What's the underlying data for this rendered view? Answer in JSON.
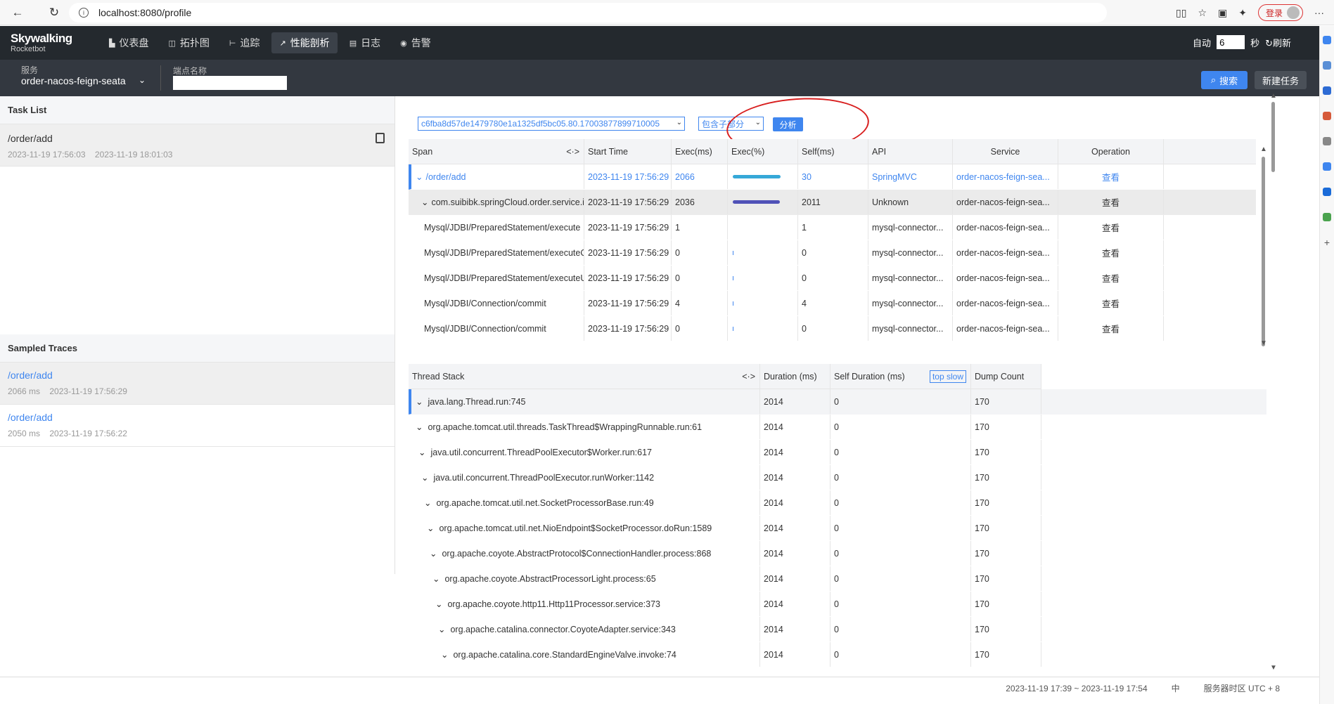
{
  "browser": {
    "url": "localhost:8080/profile",
    "login_label": "登录"
  },
  "header": {
    "logo_title": "Skywalking",
    "logo_sub": "Rocketbot",
    "nav": [
      {
        "label": "仪表盘",
        "icon": "dashboard-icon"
      },
      {
        "label": "拓扑图",
        "icon": "topology-icon"
      },
      {
        "label": "追踪",
        "icon": "trace-icon"
      },
      {
        "label": "性能剖析",
        "icon": "profile-icon",
        "active": true
      },
      {
        "label": "日志",
        "icon": "log-icon"
      },
      {
        "label": "告警",
        "icon": "alarm-icon"
      }
    ],
    "auto_label": "自动",
    "auto_value": "6",
    "seconds_label": "秒",
    "refresh_label": "刷新"
  },
  "filter": {
    "service_label": "服务",
    "service_value": "order-nacos-feign-seata",
    "endpoint_label": "端点名称",
    "endpoint_value": "",
    "search_label": "搜索",
    "new_task_label": "新建任务"
  },
  "task_list": {
    "title": "Task List",
    "items": [
      {
        "name": "/order/add",
        "start": "2023-11-19 17:56:03",
        "end": "2023-11-19 18:01:03"
      }
    ]
  },
  "sampled_traces": {
    "title": "Sampled Traces",
    "items": [
      {
        "name": "/order/add",
        "duration": "2066 ms",
        "time": "2023-11-19 17:56:29"
      },
      {
        "name": "/order/add",
        "duration": "2050 ms",
        "time": "2023-11-19 17:56:22"
      }
    ]
  },
  "analysis": {
    "segment_id": "c6fba8d57de1479780e1a1325df5bc05.80.17003877899710005",
    "mode": "包含子部分",
    "analyze_label": "分析"
  },
  "span_table": {
    "headers": [
      "Span",
      "Start Time",
      "Exec(ms)",
      "Exec(%)",
      "Self(ms)",
      "API",
      "Service",
      "Operation"
    ],
    "rows": [
      {
        "span": "/order/add",
        "start": "2023-11-19 17:56:29",
        "exec": "2066",
        "exec_pct": 1.0,
        "self": "30",
        "api": "SpringMVC",
        "service": "order-nacos-feign-sea...",
        "op": "查看",
        "level": 0,
        "expand": true,
        "blue": true
      },
      {
        "span": "com.suibibk.springCloud.order.service.imp...",
        "start": "2023-11-19 17:56:29",
        "exec": "2036",
        "exec_pct": 0.98,
        "self": "2011",
        "api": "Unknown",
        "service": "order-nacos-feign-sea...",
        "op": "查看",
        "level": 1,
        "expand": true,
        "blue": false
      },
      {
        "span": "Mysql/JDBI/PreparedStatement/execute",
        "start": "2023-11-19 17:56:29",
        "exec": "1",
        "exec_pct": 0,
        "self": "1",
        "api": "mysql-connector...",
        "service": "order-nacos-feign-sea...",
        "op": "查看",
        "level": 2,
        "expand": false,
        "blue": false
      },
      {
        "span": "Mysql/JDBI/PreparedStatement/executeQu...",
        "start": "2023-11-19 17:56:29",
        "exec": "0",
        "exec_pct": 0,
        "self": "0",
        "api": "mysql-connector...",
        "service": "order-nacos-feign-sea...",
        "op": "查看",
        "level": 2,
        "expand": false,
        "blue": false
      },
      {
        "span": "Mysql/JDBI/PreparedStatement/executeUp...",
        "start": "2023-11-19 17:56:29",
        "exec": "0",
        "exec_pct": 0,
        "self": "0",
        "api": "mysql-connector...",
        "service": "order-nacos-feign-sea...",
        "op": "查看",
        "level": 2,
        "expand": false,
        "blue": false
      },
      {
        "span": "Mysql/JDBI/Connection/commit",
        "start": "2023-11-19 17:56:29",
        "exec": "4",
        "exec_pct": 0,
        "self": "4",
        "api": "mysql-connector...",
        "service": "order-nacos-feign-sea...",
        "op": "查看",
        "level": 2,
        "expand": false,
        "blue": false
      },
      {
        "span": "Mysql/JDBI/Connection/commit",
        "start": "2023-11-19 17:56:29",
        "exec": "0",
        "exec_pct": 0,
        "self": "0",
        "api": "mysql-connector...",
        "service": "order-nacos-feign-sea...",
        "op": "查看",
        "level": 2,
        "expand": false,
        "blue": false
      }
    ]
  },
  "stack_table": {
    "headers": [
      "Thread Stack",
      "Duration (ms)",
      "Self Duration (ms)",
      "Dump Count"
    ],
    "top_slow_label": "top slow",
    "rows": [
      {
        "name": "java.lang.Thread.run:745",
        "duration": "2014",
        "self": "0",
        "count": "170"
      },
      {
        "name": "org.apache.tomcat.util.threads.TaskThread$WrappingRunnable.run:61",
        "duration": "2014",
        "self": "0",
        "count": "170"
      },
      {
        "name": "java.util.concurrent.ThreadPoolExecutor$Worker.run:617",
        "duration": "2014",
        "self": "0",
        "count": "170"
      },
      {
        "name": "java.util.concurrent.ThreadPoolExecutor.runWorker:1142",
        "duration": "2014",
        "self": "0",
        "count": "170"
      },
      {
        "name": "org.apache.tomcat.util.net.SocketProcessorBase.run:49",
        "duration": "2014",
        "self": "0",
        "count": "170"
      },
      {
        "name": "org.apache.tomcat.util.net.NioEndpoint$SocketProcessor.doRun:1589",
        "duration": "2014",
        "self": "0",
        "count": "170"
      },
      {
        "name": "org.apache.coyote.AbstractProtocol$ConnectionHandler.process:868",
        "duration": "2014",
        "self": "0",
        "count": "170"
      },
      {
        "name": "org.apache.coyote.AbstractProcessorLight.process:65",
        "duration": "2014",
        "self": "0",
        "count": "170"
      },
      {
        "name": "org.apache.coyote.http11.Http11Processor.service:373",
        "duration": "2014",
        "self": "0",
        "count": "170"
      },
      {
        "name": "org.apache.catalina.connector.CoyoteAdapter.service:343",
        "duration": "2014",
        "self": "0",
        "count": "170"
      },
      {
        "name": "org.apache.catalina.core.StandardEngineValve.invoke:74",
        "duration": "2014",
        "self": "0",
        "count": "170"
      }
    ]
  },
  "footer": {
    "time_range": "2023-11-19 17:39 ~ 2023-11-19 17:54",
    "lang": "中",
    "timezone": "服务器时区 UTC + 8"
  },
  "colors": {
    "accent": "#3f86ef",
    "header_bg": "#24292e",
    "bar_top": "#36a8d8",
    "bar_second": "#5052b8",
    "annotation": "#d81e1e"
  }
}
